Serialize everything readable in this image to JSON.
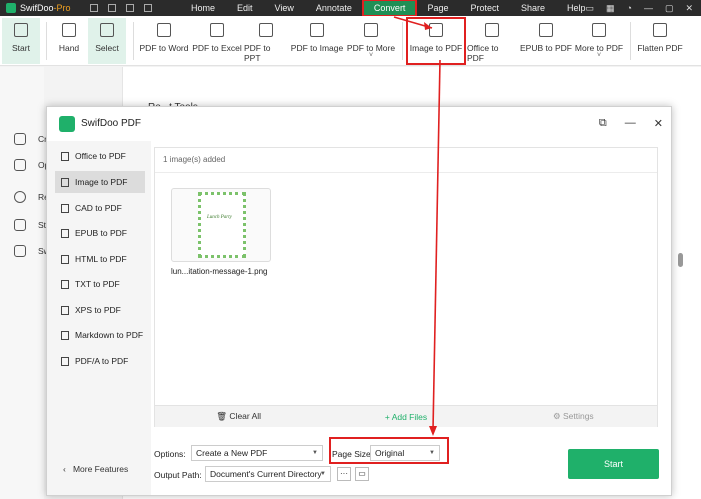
{
  "app": {
    "name": "SwifDoo",
    "name_suffix": "-Pro"
  },
  "menu": [
    "Home",
    "Edit",
    "View",
    "Annotate",
    "Convert",
    "Page",
    "Protect",
    "Share",
    "Help"
  ],
  "ribbon": {
    "start": "Start",
    "hand": "Hand",
    "select": "Select",
    "pdf_to_word": "PDF to Word",
    "pdf_to_excel": "PDF to Excel",
    "pdf_to_ppt": "PDF to PPT",
    "pdf_to_image": "PDF to Image",
    "pdf_to_more": "PDF to More",
    "image_to_pdf": "Image to PDF",
    "office_to_pdf": "Office to PDF",
    "epub_to_pdf": "EPUB to PDF",
    "more_to_pdf": "More to PDF",
    "flatten_pdf": "Flatten PDF",
    "dropdown_glyph": "˅"
  },
  "background": {
    "nav": [
      "Cr",
      "Op",
      "Re",
      "St",
      "Sw"
    ],
    "panel_title": "Re...t Tools"
  },
  "dialog": {
    "title": "SwifDoo PDF",
    "sidebar": [
      "Office to PDF",
      "Image to PDF",
      "CAD to PDF",
      "EPUB to PDF",
      "HTML to PDF",
      "TXT to PDF",
      "XPS to PDF",
      "Markdown to PDF",
      "PDF/A to PDF"
    ],
    "more_features": "More Features",
    "files_count": "1 image(s) added",
    "file_name": "lun...itation-message-1.png",
    "thumb_text": "Lunch Party",
    "clear_all": "Clear All",
    "add_files": "+ Add Files",
    "settings": "Settings",
    "options_label": "Options:",
    "options_value": "Create a New PDF",
    "page_size_label": "Page Size:",
    "page_size_value": "Original",
    "output_label": "Output Path:",
    "output_value": "Document's Current Directory",
    "more_btn": "···",
    "start_button": "Start"
  },
  "colors": {
    "accent": "#1fb06a",
    "annotation": "#e02020",
    "menu_bg": "#2b2b2b"
  }
}
